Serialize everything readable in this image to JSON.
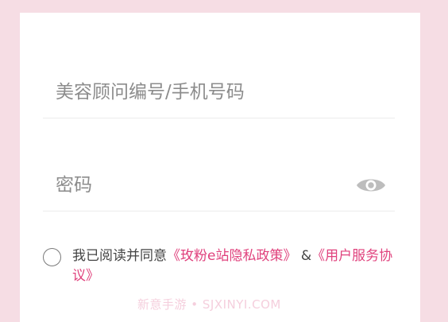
{
  "login_form": {
    "account_placeholder": "美容顾问编号/手机号码",
    "password_placeholder": "密码",
    "password_toggle_icon": "eye-icon"
  },
  "agreement": {
    "prefix": "我已阅读并同意",
    "privacy_link": "《玫粉e站隐私政策》",
    "separator": "&",
    "service_link": "《用户服务协议》",
    "checked": false
  },
  "watermark": "新意手游 • SJXINYI.COM",
  "colors": {
    "background": "#f6dde4",
    "card": "#ffffff",
    "link": "#e0427d",
    "placeholder": "#8c8c8c"
  }
}
